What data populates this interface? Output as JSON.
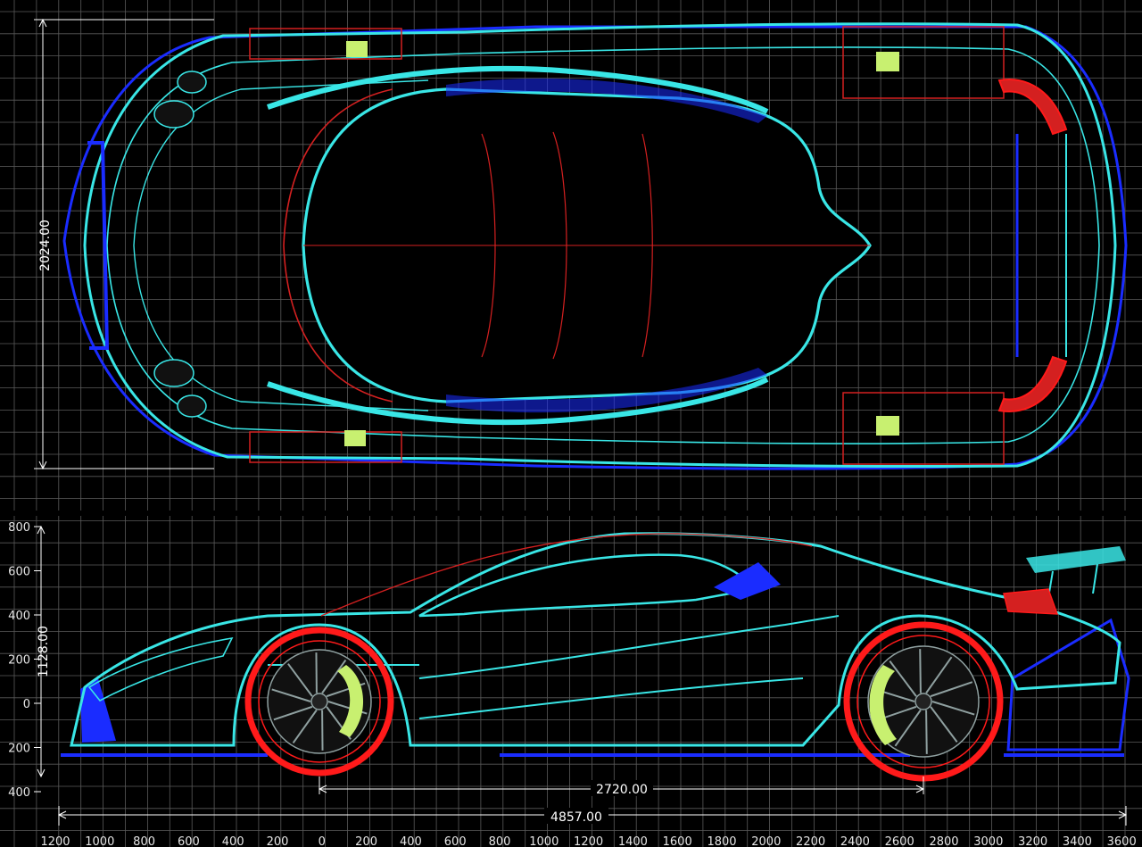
{
  "colors": {
    "background": "#000000",
    "grid": "#5a5a5a",
    "body_wire": "#39e6e6",
    "outline_blue": "#1a2cff",
    "wheel_red": "#ff1a1a",
    "accent_red": "#d42020",
    "caliper": "#c8f070",
    "dimension": "#ffffff"
  },
  "top_view": {
    "height_dimension_label": "2024.00"
  },
  "side_view": {
    "height_dimension_label": "1128.00",
    "wheelbase_label": "2720.00",
    "length_label": "4857.00",
    "y_axis_ticks": [
      "800",
      "600",
      "400",
      "200",
      "0",
      "200",
      "400"
    ],
    "x_axis_ticks": [
      "1200",
      "1000",
      "800",
      "600",
      "400",
      "200",
      "0",
      "200",
      "400",
      "600",
      "800",
      "1000",
      "1200",
      "1400",
      "1600",
      "1800",
      "2000",
      "2200",
      "2400",
      "2600",
      "2800",
      "3000",
      "3200",
      "3400",
      "3600"
    ]
  }
}
